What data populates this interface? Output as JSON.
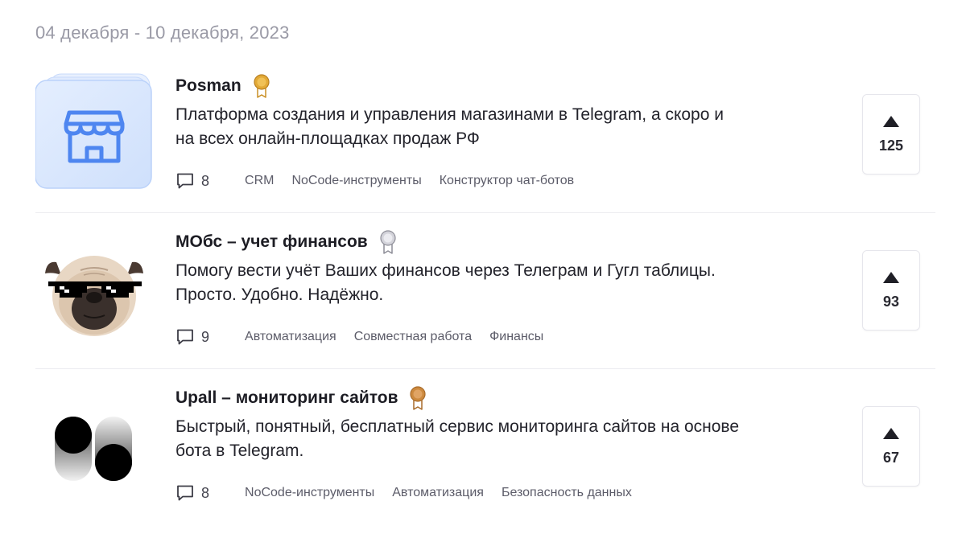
{
  "header": {
    "date_range": "04 декабря - 10 декабря, 2023"
  },
  "products": [
    {
      "name": "Posman",
      "medal_color": "#E2A936",
      "description_line1": "Платформа создания и управления магазинами в Telegram, а скоро и",
      "description_line2": "на всех онлайн-площадках продаж РФ",
      "comments": "8",
      "tags": [
        "CRM",
        "NoCode-инструменты",
        "Конструктор чат-ботов"
      ],
      "votes": "125",
      "thumbnail_icon": "storefront-icon"
    },
    {
      "name": "МОбс – учет финансов",
      "medal_color": "#A9A9B2",
      "description_line1": "Помогу вести учёт Ваших финансов через Телеграм и Гугл таблицы.",
      "description_line2": "Просто. Удобно. Надёжно.",
      "comments": "9",
      "tags": [
        "Автоматизация",
        "Совместная работа",
        "Финансы"
      ],
      "votes": "93",
      "thumbnail_icon": "pug-sunglasses-image"
    },
    {
      "name": "Upall – мониторинг сайтов",
      "medal_color": "#CD8A3F",
      "description_line1": "Быстрый, понятный, бесплатный сервис мониторинга сайтов на основе",
      "description_line2": "бота в Telegram.",
      "comments": "8",
      "tags": [
        "NoCode-инструменты",
        "Автоматизация",
        "Безопасность данных"
      ],
      "votes": "67",
      "thumbnail_icon": "upall-logo"
    }
  ],
  "colors": {
    "accent_blue": "#4E86F0",
    "thumb_bg_blue": "#D9E7FD",
    "gold": "#E2A936",
    "silver": "#A9A9B2",
    "bronze": "#CD8A3F"
  }
}
